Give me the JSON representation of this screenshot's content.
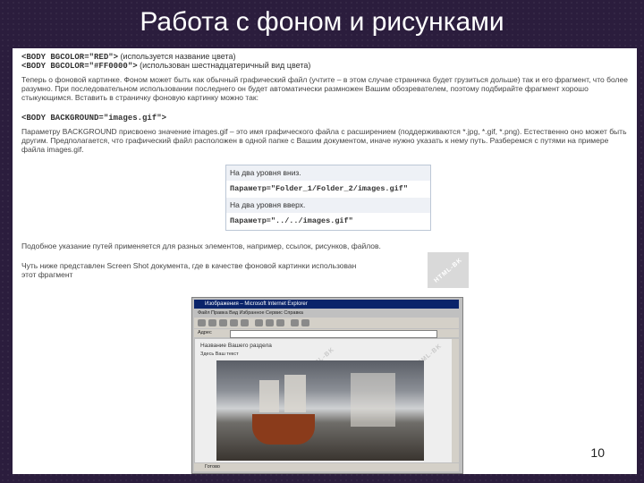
{
  "slide": {
    "title": "Работа с фоном и рисунками",
    "number": "10"
  },
  "content": {
    "line1_code": "<BODY BGCOLOR=\"RED\">",
    "line1_note": "(используется название цвета)",
    "line2_code": "<BODY BGCOLOR=\"#FF0000\">",
    "line2_note": "(использован шестнадцатеричный вид цвета)",
    "para1": "Теперь о фоновой картинке. Фоном может быть как обычный графический файл (учтите – в этом случае страничка будет грузиться дольше) так и его фрагмент, что более разумно. При последовательном использовании последнего он будет автоматически размножен Вашим обозревателем, поэтому подбирайте фрагмент хорошо стыкующимся. Вставить в страничку фоновую картинку можно так:",
    "code2": "<BODY BACKGROUND=\"images.gif\">",
    "para2": "Параметру BACKGROUND присвоено значение images.gif – это имя графического файла с расширением (поддерживаются *.jpg, *.gif, *.png). Естественно оно может быть другим. Предполагается, что графический файл расположен в одной папке с Вашим документом, иначе нужно указать к нему путь. Разберемся с путями на примере файла images.gif.",
    "table": {
      "row1": "На два уровня вниз.",
      "row2": "Параметр=\"Folder_1/Folder_2/images.gif\"",
      "row3": "На два уровня вверх.",
      "row4": "Параметр=\"../../images.gif\""
    },
    "para3": "Подобное указание путей применяется для разных элементов, например, ссылок, рисунков, файлов.",
    "para4a": "Чуть ниже представлен Screen Shot документа, где в качестве фоновой картинки использован",
    "para4b": "этот фрагмент",
    "watermark": "HTML-BK"
  },
  "browser": {
    "title": "Изображения – Microsoft Internet Explorer",
    "menu": "Файл  Правка  Вид  Избранное  Сервис  Справка",
    "address_label": "Адрес",
    "page_heading": "Название Вашего раздела",
    "page_text": "Здесь Ваш текст",
    "status": "Готово"
  }
}
